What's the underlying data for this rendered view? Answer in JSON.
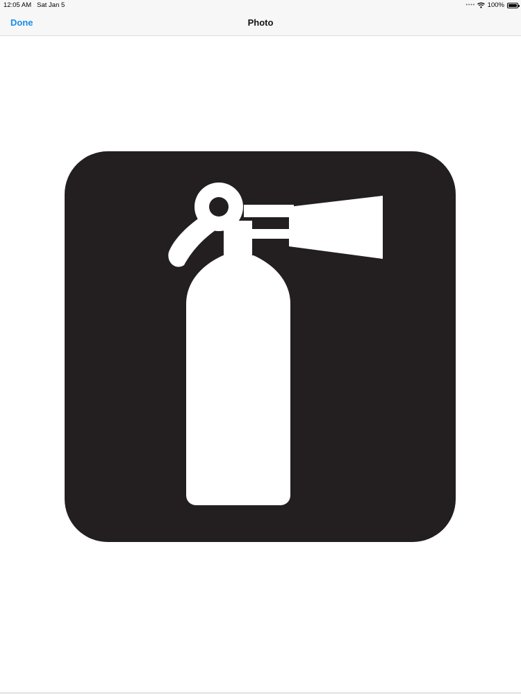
{
  "status_bar": {
    "time": "12:05 AM",
    "date": "Sat Jan 5",
    "battery": "100%"
  },
  "nav": {
    "done_label": "Done",
    "title": "Photo"
  },
  "photo": {
    "subject": "fire-extinguisher-icon",
    "background_color": "#231f20",
    "foreground_color": "#ffffff"
  },
  "colors": {
    "accent": "#1a8ce6"
  }
}
